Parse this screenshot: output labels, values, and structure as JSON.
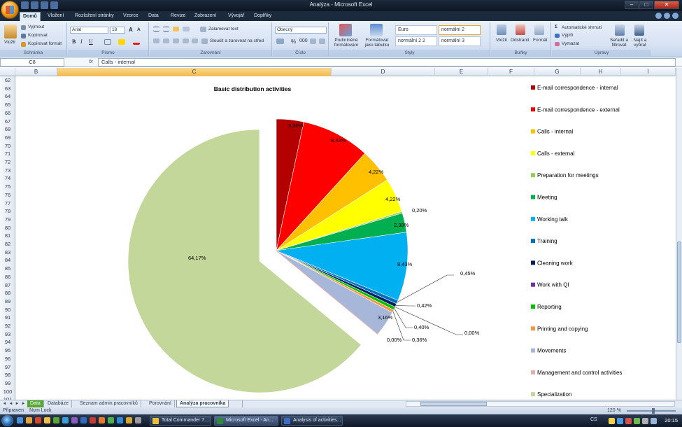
{
  "window": {
    "title": "Analýza - Microsoft Excel",
    "minimize": "–",
    "maximize": "□",
    "close": "✕"
  },
  "ribbon_tabs": [
    "Domů",
    "Vložení",
    "Rozložení stránky",
    "Vzorce",
    "Data",
    "Revize",
    "Zobrazení",
    "Vývojář",
    "Doplňky"
  ],
  "ribbon": {
    "clipboard": {
      "paste": "Vložit",
      "cut": "Vyjmout",
      "copy": "Kopírovat",
      "format_painter": "Kopírovat formát",
      "label": "Schránka"
    },
    "font": {
      "name": "Arial",
      "size": "18",
      "label": "Písmo"
    },
    "alignment": {
      "wrap": "Zalamovat text",
      "merge": "Sloučit a zarovnat na střed",
      "label": "Zarovnání"
    },
    "number": {
      "format": "Obecný",
      "label": "Číslo"
    },
    "styles": {
      "conditional": "Podmíněné formátování",
      "as_table": "Formátovat jako tabulku",
      "cells": [
        "Euro",
        "normální 2",
        "normální 2 2",
        "normální 3"
      ],
      "label": "Styly"
    },
    "cells": {
      "insert": "Vložit",
      "delete": "Odstranit",
      "format": "Formát",
      "label": "Buňky"
    },
    "editing": {
      "autosum": "Automatické shrnutí",
      "fill": "Výplň",
      "clear": "Vymazat",
      "sort": "Seřadit a filtrovat",
      "find": "Najít a vybrat",
      "label": "Úpravy"
    }
  },
  "formula_bar": {
    "name_box": "C8",
    "fx": "fx",
    "content": "Calls - internal"
  },
  "columns": [
    "B",
    "C",
    "D",
    "E",
    "F",
    "G",
    "H",
    "I"
  ],
  "rows": [
    "62",
    "63",
    "64",
    "65",
    "66",
    "67",
    "68",
    "69",
    "70",
    "71",
    "72",
    "73",
    "74",
    "75",
    "76",
    "77",
    "78",
    "79",
    "80",
    "81",
    "82",
    "83",
    "84",
    "85",
    "86",
    "87",
    "88",
    "89",
    "90",
    "91",
    "92",
    "93",
    "94",
    "95",
    "96",
    "97",
    "98",
    "99",
    "100",
    "101"
  ],
  "chart_data": {
    "type": "pie",
    "title": "Basic distribution activities",
    "legend_position": "right",
    "series": [
      {
        "name": "E-mail correspondence - internal",
        "value": 3.36,
        "label": "3,36%",
        "color": "#b30000"
      },
      {
        "name": "E-mail correspondence - external",
        "value": 8.43,
        "label": "8,43%",
        "color": "#ff0000"
      },
      {
        "name": "Calls - internal",
        "value": 4.22,
        "label": "4,22%",
        "color": "#ffc000"
      },
      {
        "name": "Calls - external",
        "value": 4.22,
        "label": "4,22%",
        "color": "#ffff00"
      },
      {
        "name": "Preparation for meetings",
        "value": 0.2,
        "label": "0,20%",
        "color": "#92d050"
      },
      {
        "name": "Meeting",
        "value": 2.38,
        "label": "2,38%",
        "color": "#00b050"
      },
      {
        "name": "Working talk",
        "value": 8.43,
        "label": "8,43%",
        "color": "#00b0f0"
      },
      {
        "name": "Training",
        "value": 0.45,
        "label": "0,45%",
        "color": "#0070c0"
      },
      {
        "name": "Cleaning work",
        "value": 0.42,
        "label": "0,42%",
        "color": "#002060"
      },
      {
        "name": "Work with QI",
        "value": 0.0,
        "label": "0,00%",
        "color": "#7030a0"
      },
      {
        "name": "Reporting",
        "value": 0.4,
        "label": "0,40%",
        "color": "#00c000"
      },
      {
        "name": "Printing and copying",
        "value": 0.36,
        "label": "0,36%",
        "color": "#f79646"
      },
      {
        "name": "Movements",
        "value": 3.16,
        "label": "3,16%",
        "color": "#a6b7d9"
      },
      {
        "name": "Management and control activities",
        "value": 0.0,
        "label": "0,00%",
        "color": "#e6b0a8"
      },
      {
        "name": "Specialization",
        "value": 64.17,
        "label": "64,17%",
        "color": "#c4d79b"
      }
    ]
  },
  "sheet_tabs": [
    "Data",
    "Databáze",
    "Seznam admin.pracovníků",
    "Porovnání",
    "Analýza pracovníka"
  ],
  "status": {
    "ready": "Připraven",
    "numlock": "Num Lock",
    "zoom": "120 %"
  },
  "taskbar": {
    "items": [
      "Total Commander 7....",
      "Microsoft Excel - An...",
      "Analysis of activities..."
    ],
    "lang": "CS",
    "clock": "20:15"
  }
}
